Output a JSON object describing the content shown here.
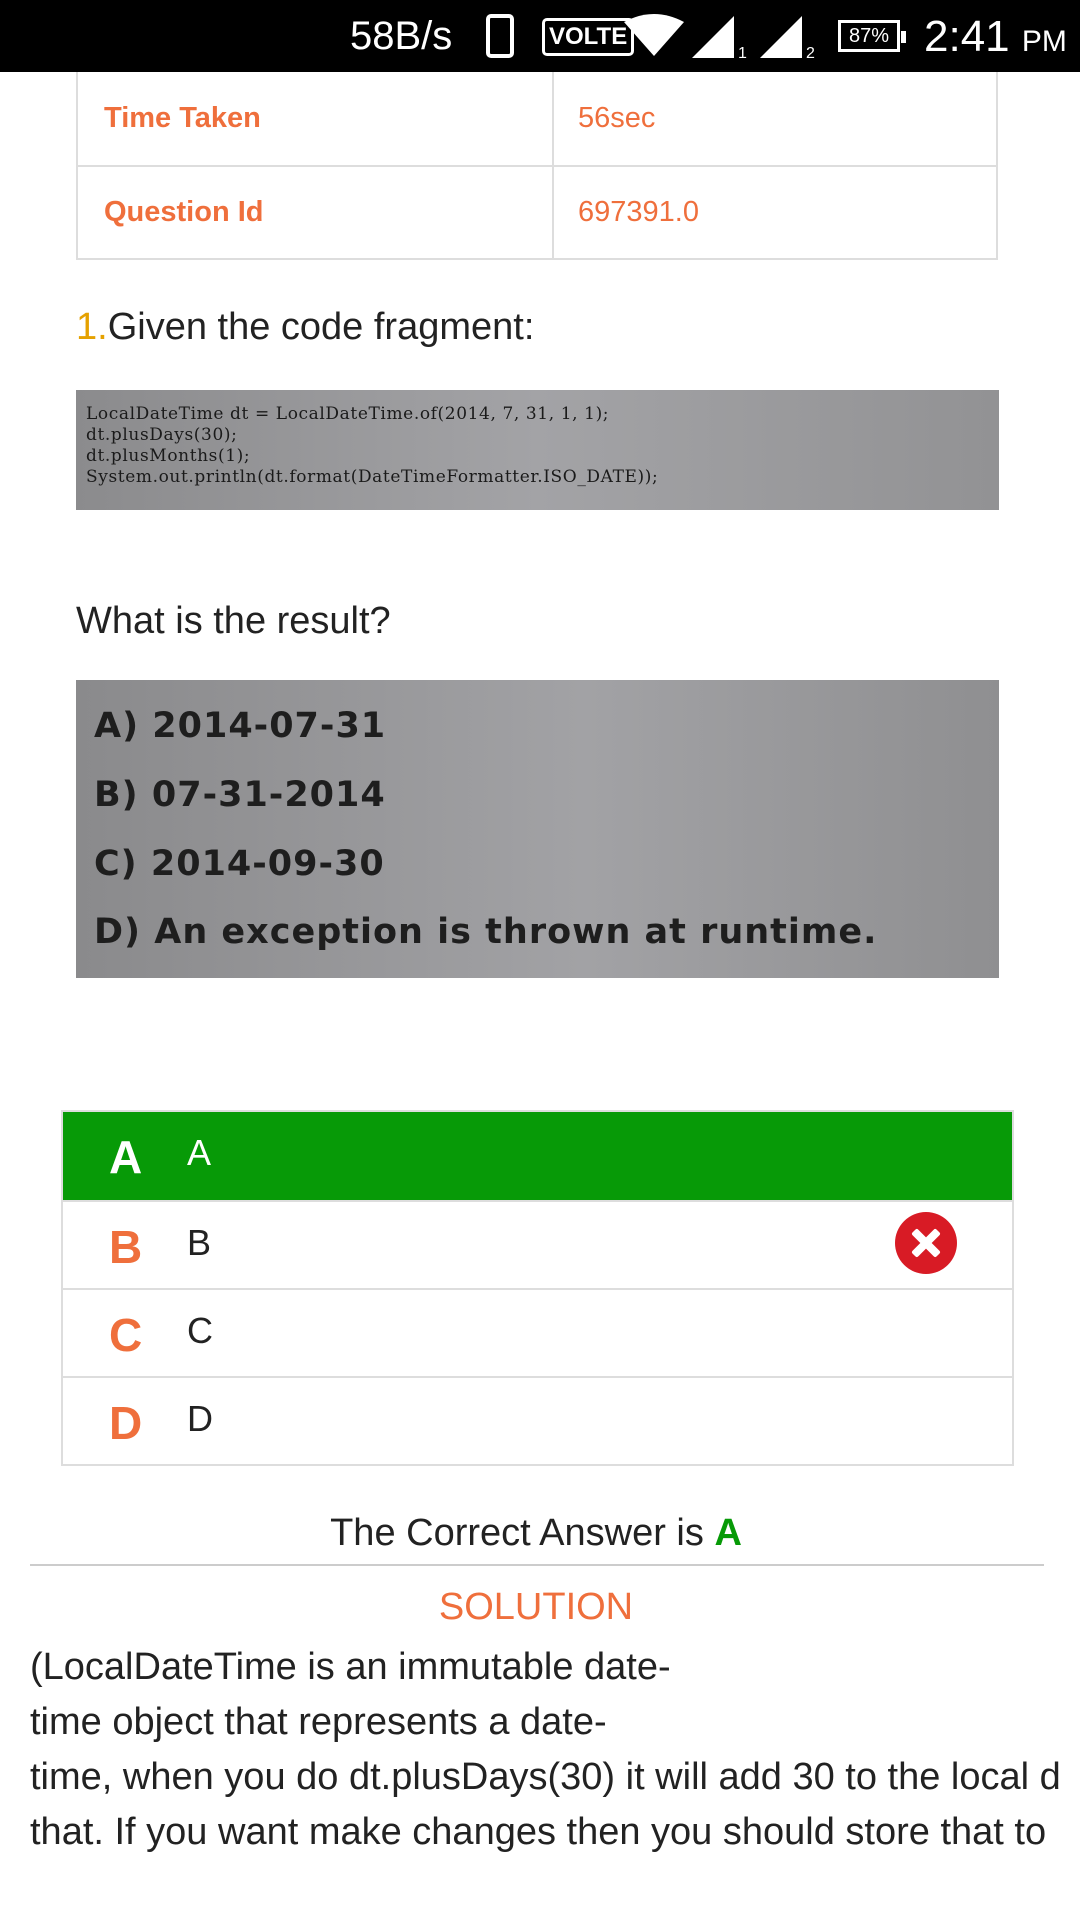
{
  "status_bar": {
    "net_speed": "58B/s",
    "volte": "VOLTE",
    "sim1": "1",
    "sim2": "2",
    "battery": "87%",
    "time": "2:41",
    "ampm": "PM"
  },
  "info": [
    {
      "label": "Time Taken",
      "value": "56sec"
    },
    {
      "label": "Question Id",
      "value": "697391.0"
    }
  ],
  "question": {
    "number": "1.",
    "text": "Given the code fragment:",
    "code": "LocalDateTime dt = LocalDateTime.of(2014, 7, 31, 1, 1);\ndt.plusDays(30);\ndt.plusMonths(1);\nSystem.out.println(dt.format(DateTimeFormatter.ISO_DATE));",
    "prompt": "What is the result?",
    "options": [
      "A) 2014-07-31",
      "B) 07-31-2014",
      "C) 2014-09-30",
      "D) An exception is thrown at runtime."
    ]
  },
  "answers": [
    {
      "letter": "A",
      "text": "A",
      "state": "correct"
    },
    {
      "letter": "B",
      "text": "B",
      "state": "wrong"
    },
    {
      "letter": "C",
      "text": "C",
      "state": "none"
    },
    {
      "letter": "D",
      "text": "D",
      "state": "none"
    }
  ],
  "result": {
    "prefix": "The Correct Answer is",
    "letter": "A"
  },
  "solution": {
    "title": "SOLUTION",
    "lines": [
      "(LocalDateTime is an immutable  date-",
      "time object that represents a date-",
      "time, when you do dt.plusDays(30) it will add 30 to the local d",
      "that. If you want make changes then you should store that to"
    ]
  },
  "colors": {
    "accent_orange": "#ef6f3c",
    "correct_green": "#079a07",
    "wrong_red": "#d81b25",
    "number_gold": "#e5a100"
  }
}
